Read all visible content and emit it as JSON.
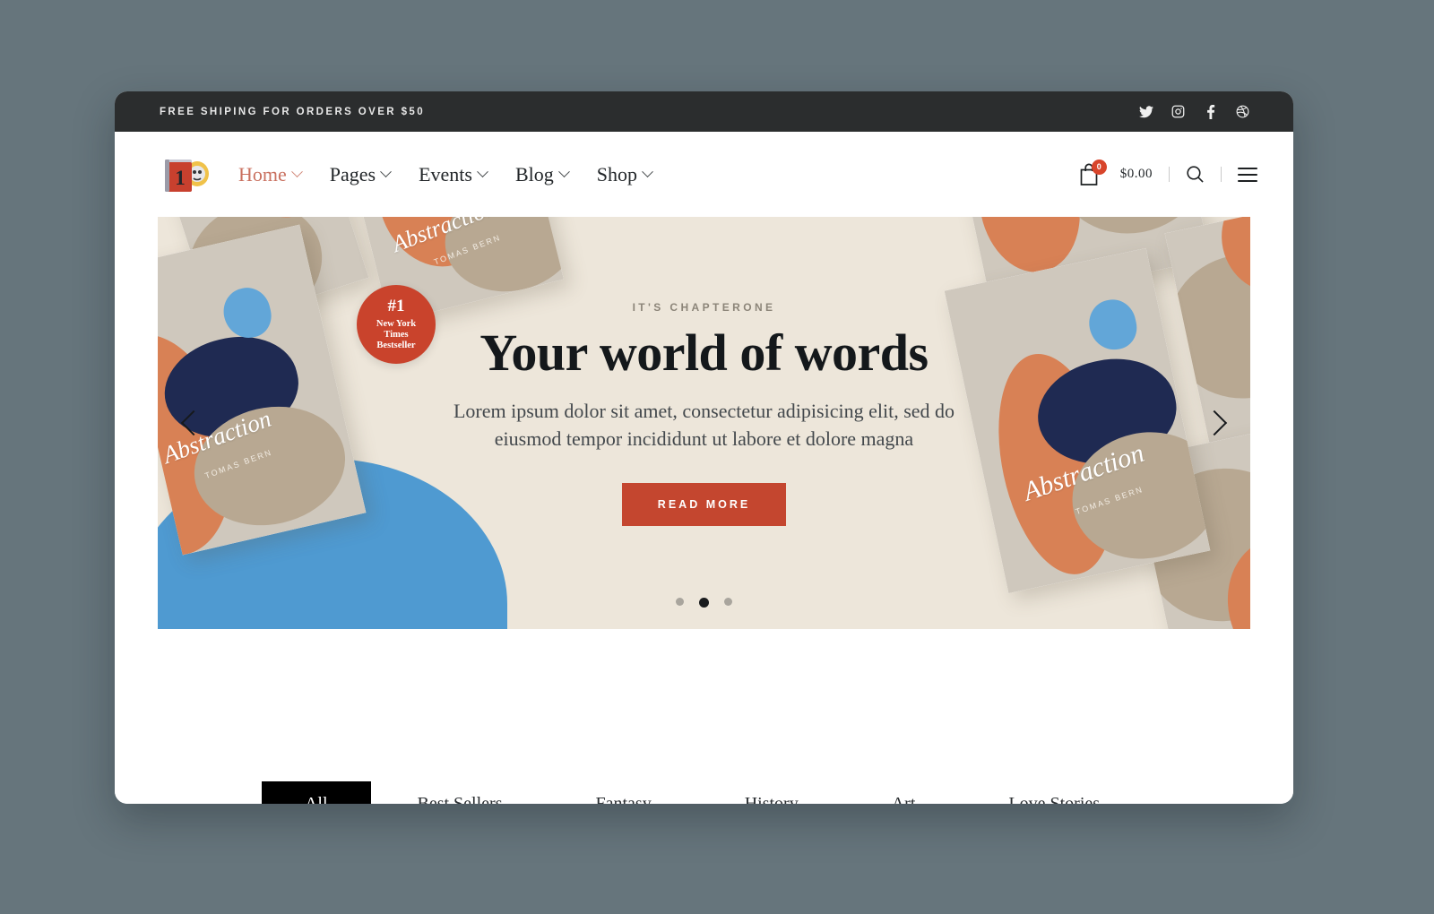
{
  "theme": {
    "page_background": "#66757c",
    "topbar_background": "#2b2d2e",
    "hero_background": "#ede6da",
    "accent_red": "#c4462f",
    "badge_red": "#d8452b",
    "nav_active": "#c9705f"
  },
  "topbar": {
    "announcement": "FREE SHIPING FOR ORDERS OVER $50",
    "social": [
      {
        "name": "twitter-icon",
        "label": "Twitter"
      },
      {
        "name": "instagram-icon",
        "label": "Instagram"
      },
      {
        "name": "facebook-icon",
        "label": "Facebook"
      },
      {
        "name": "dribbble-icon",
        "label": "Dribbble"
      }
    ]
  },
  "header": {
    "logo_alt": "Chapter One book logo",
    "nav": [
      {
        "label": "Home",
        "active": true,
        "has_dropdown": true
      },
      {
        "label": "Pages",
        "active": false,
        "has_dropdown": true
      },
      {
        "label": "Events",
        "active": false,
        "has_dropdown": true
      },
      {
        "label": "Blog",
        "active": false,
        "has_dropdown": true
      },
      {
        "label": "Shop",
        "active": false,
        "has_dropdown": true
      }
    ],
    "cart_count": "0",
    "cart_total": "$0.00",
    "search_icon": "search-icon",
    "menu_icon": "hamburger-menu-icon"
  },
  "hero": {
    "eyebrow": "IT'S CHAPTERONE",
    "title": "Your world of words",
    "subtitle": "Lorem ipsum dolor sit amet, consectetur adipisicing elit, sed do eiusmod tempor incididunt ut labore et dolore magna",
    "cta_label": "READ MORE",
    "book_title": "Abstraction",
    "book_author": "TOMAS BERN",
    "badge_rank": "#1",
    "badge_text_lines": [
      "New York",
      "Times",
      "Bestseller"
    ],
    "prev_label": "Previous slide",
    "next_label": "Next slide",
    "slides": [
      {
        "index": 1,
        "active": false
      },
      {
        "index": 2,
        "active": true
      },
      {
        "index": 3,
        "active": false
      }
    ]
  },
  "filters": {
    "items": [
      {
        "label": "All",
        "active": true
      },
      {
        "label": "Best Sellers",
        "active": false
      },
      {
        "label": "Fantasy",
        "active": false
      },
      {
        "label": "History",
        "active": false
      },
      {
        "label": "Art",
        "active": false
      },
      {
        "label": "Love Stories",
        "active": false
      }
    ]
  }
}
